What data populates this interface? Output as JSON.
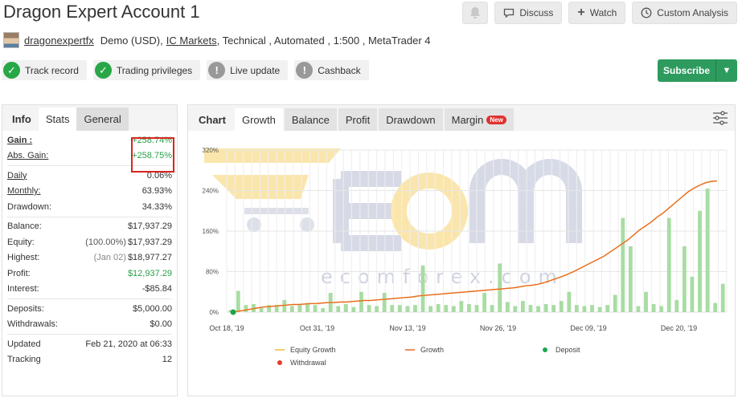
{
  "header": {
    "title": "Dragon Expert Account 1"
  },
  "actions": {
    "discuss": "Discuss",
    "watch": "Watch",
    "custom": "Custom Analysis"
  },
  "meta": {
    "user": "dragonexpertfx",
    "pre": "Demo (USD),",
    "broker": "IC Markets",
    "post": ", Technical , Automated , 1:500 , MetaTrader 4"
  },
  "badges": [
    "Track record",
    "Trading privileges",
    "Live update",
    "Cashback"
  ],
  "subscribe": {
    "label": "Subscribe"
  },
  "stats": {
    "tabs": [
      "Info",
      "Stats",
      "General"
    ],
    "gain": {
      "label": "Gain :",
      "value": "+258.74%"
    },
    "abs_gain": {
      "label": "Abs. Gain:",
      "value": "+258.75%"
    },
    "daily": {
      "label": "Daily",
      "value": "0.06%"
    },
    "monthly": {
      "label": "Monthly:",
      "value": "63.93%"
    },
    "drawdown": {
      "label": "Drawdown:",
      "value": "34.33%"
    },
    "balance": {
      "label": "Balance:",
      "value": "$17,937.29"
    },
    "equity": {
      "label": "Equity:",
      "sub": "(100.00%)",
      "value": "$17,937.29"
    },
    "highest": {
      "label": "Highest:",
      "sub": "(Jan 02)",
      "value": "$18,977.27"
    },
    "profit": {
      "label": "Profit:",
      "value": "$12,937.29"
    },
    "interest": {
      "label": "Interest:",
      "value": "-$85.84"
    },
    "deposits": {
      "label": "Deposits:",
      "value": "$5,000.00"
    },
    "withdrawals": {
      "label": "Withdrawals:",
      "value": "$0.00"
    },
    "updated": {
      "label": "Updated",
      "value": "Feb 21, 2020 at 06:33"
    },
    "tracking": {
      "label": "Tracking",
      "value": "12"
    }
  },
  "chart_tabs": [
    "Chart",
    "Growth",
    "Balance",
    "Profit",
    "Drawdown",
    "Margin"
  ],
  "chart_new_tag": "New",
  "watermark": {
    "brand": "ecomforex.com"
  },
  "colors": {
    "accent": "#2e9b5e",
    "growth": "#e8652a",
    "equity": "#f0b93a",
    "bars": "#a8dca3",
    "deposit": "#1aa64a",
    "withdrawal": "#e23b2e"
  },
  "chart_data": {
    "type": "line",
    "xticks": [
      "Oct 18, '19",
      "Oct 31, '19",
      "Nov 13, '19",
      "Nov 26, '19",
      "Dec 09, '19",
      "Dec 20, '19"
    ],
    "yticks": [
      "0%",
      "80%",
      "160%",
      "240%",
      "320%"
    ],
    "ylim": [
      0,
      320
    ],
    "legend": [
      "Equity Growth",
      "Growth",
      "Deposit",
      "Withdrawal"
    ],
    "series": [
      {
        "name": "Growth",
        "values": [
          0,
          2,
          4,
          6,
          8,
          10,
          11,
          12,
          13,
          14,
          15,
          15,
          16,
          17,
          17,
          18,
          19,
          19,
          20,
          20,
          21,
          22,
          23,
          23,
          24,
          25,
          26,
          27,
          28,
          29,
          30,
          32,
          33,
          34,
          35,
          36,
          37,
          38,
          39,
          40,
          41,
          42,
          43,
          44,
          45,
          46,
          47,
          48,
          50,
          52,
          53,
          55,
          58,
          62,
          66,
          70,
          75,
          80,
          86,
          92,
          98,
          104,
          110,
          118,
          126,
          134,
          142,
          152,
          162,
          170,
          178,
          188,
          196,
          206,
          216,
          226,
          236,
          244,
          250,
          255,
          258,
          259
        ]
      },
      {
        "name": "Equity Growth",
        "values": [
          0,
          2,
          4,
          6,
          8,
          10,
          11,
          12,
          13,
          14,
          15,
          15,
          16,
          17,
          17,
          18,
          19,
          19,
          20,
          20,
          21,
          22,
          23,
          23,
          24,
          25,
          26,
          27,
          28,
          29,
          30,
          32,
          33,
          34,
          35,
          36,
          37,
          38,
          39,
          40,
          41,
          42,
          43,
          44,
          45,
          46,
          47,
          48,
          50,
          52,
          53,
          55,
          58,
          62,
          66,
          70,
          75,
          80,
          86,
          92,
          98,
          104,
          110,
          118,
          126,
          134,
          142,
          152,
          162,
          170,
          178,
          188,
          196,
          206,
          216,
          226,
          236,
          244,
          250,
          255,
          258,
          259
        ]
      }
    ],
    "bars": [
      4,
      42,
      14,
      16,
      8,
      14,
      14,
      24,
      12,
      14,
      18,
      14,
      8,
      38,
      12,
      16,
      10,
      40,
      14,
      12,
      38,
      14,
      14,
      12,
      14,
      92,
      12,
      16,
      14,
      12,
      22,
      16,
      14,
      38,
      14,
      96,
      20,
      12,
      22,
      14,
      12,
      16,
      14,
      22,
      40,
      14,
      12,
      14,
      10,
      14,
      34,
      186,
      130,
      12,
      40,
      16,
      12,
      186,
      24,
      130,
      70,
      200,
      244,
      18,
      56
    ],
    "deposit": {
      "x": 0,
      "value": 0
    }
  }
}
